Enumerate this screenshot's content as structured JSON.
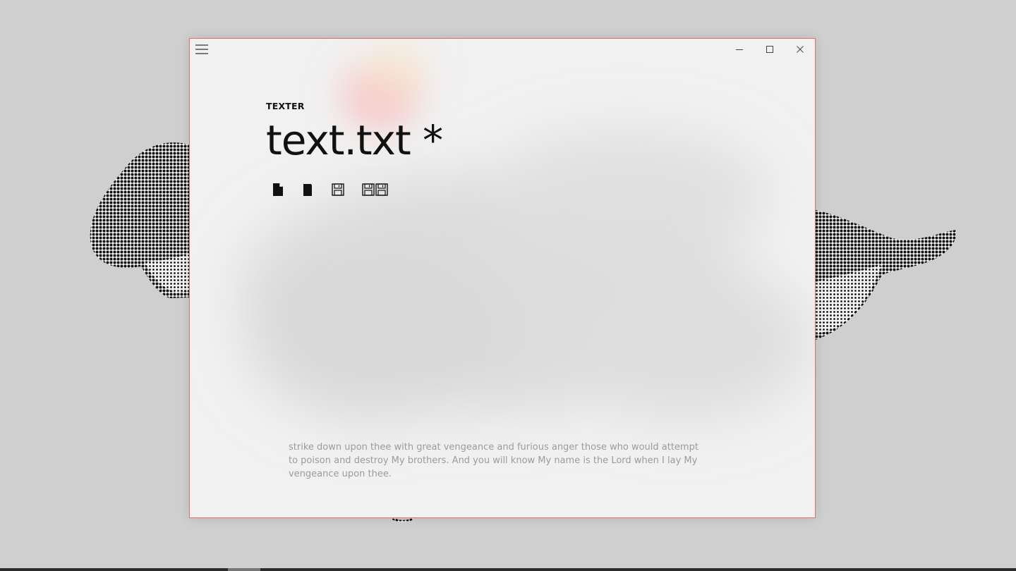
{
  "window": {
    "app_label": "TEXTER",
    "document_title": "text.txt *"
  },
  "titlebar": {
    "menu_icon": "hamburger-icon",
    "controls": [
      "minimize-icon",
      "maximize-icon",
      "close-icon"
    ]
  },
  "toolbar": {
    "buttons": [
      "new-file-icon",
      "open-file-icon",
      "save-icon",
      "save-as-icon"
    ]
  },
  "editor": {
    "text": "strike down upon thee with great vengeance and furious anger those who would attempt to poison and destroy My brothers. And you will know My name is the Lord when I lay My vengeance upon thee."
  },
  "colors": {
    "window_border": "#e07070",
    "window_background": "#f1f1f1",
    "desktop_background": "#cfcfcf",
    "text_primary": "#111111",
    "text_faded": "#9b9b9b"
  }
}
